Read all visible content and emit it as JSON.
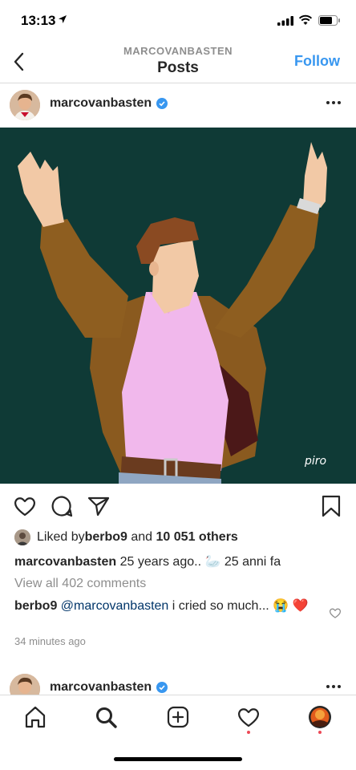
{
  "status_bar": {
    "time": "13:13"
  },
  "header": {
    "account": "MARCOVANBASTEN",
    "title": "Posts",
    "follow_label": "Follow"
  },
  "post": {
    "username": "marcovanbasten",
    "image_signature": "piro",
    "likes": {
      "prefix": "Liked by ",
      "liker": "berbo9",
      "middle": " and ",
      "others": "10 051 others"
    },
    "caption": {
      "username": "marcovanbasten",
      "text": " 25 years ago.. 🦢 25 anni fa"
    },
    "view_comments": "View all 402 comments",
    "comment": {
      "username": "berbo9",
      "mention": "@marcovanbasten",
      "text": " i cried so much... 😭 ❤️"
    },
    "timestamp": "34 minutes ago"
  },
  "next_post": {
    "username": "marcovanbasten"
  },
  "colors": {
    "accent": "#3897f0",
    "image_bg": "#0f3a36",
    "notification_dot": "#ed4956"
  }
}
